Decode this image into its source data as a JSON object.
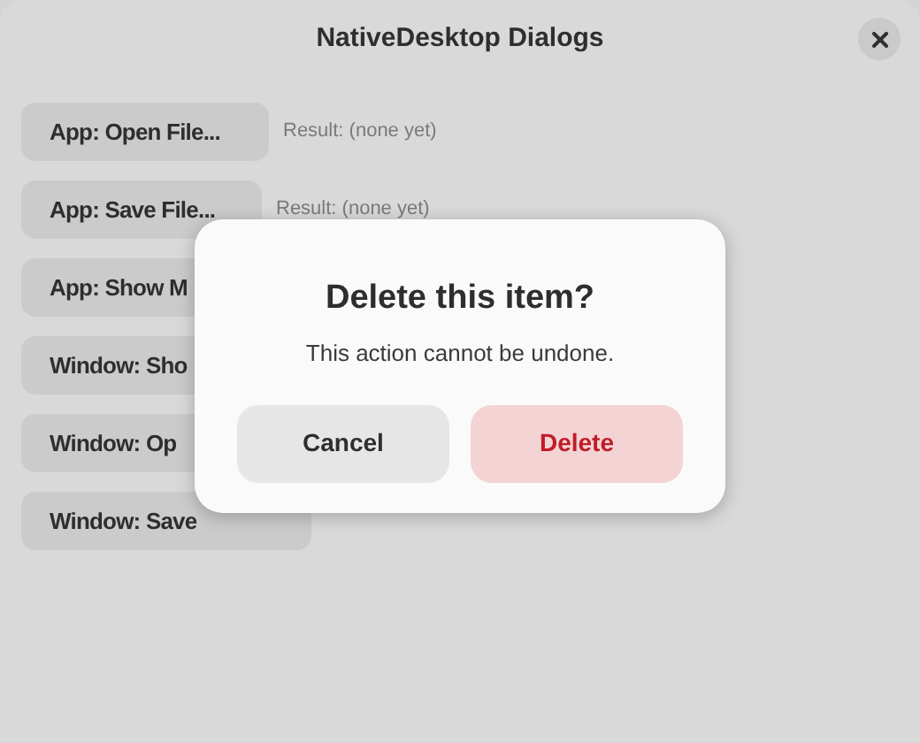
{
  "window": {
    "title": "NativeDesktop Dialogs"
  },
  "actions": [
    {
      "label": "App: Open File...",
      "result": "Result: (none yet)"
    },
    {
      "label": "App: Save File...",
      "result": "Result: (none yet)"
    },
    {
      "label": "App: Show M"
    },
    {
      "label": "Window: Sho"
    },
    {
      "label": "Window: Op"
    },
    {
      "label": "Window: Save"
    }
  ],
  "dialog": {
    "title": "Delete this item?",
    "message": "This action cannot be undone.",
    "buttons": [
      {
        "label": "Cancel",
        "kind": "cancel"
      },
      {
        "label": "Delete",
        "kind": "destructive"
      }
    ]
  }
}
